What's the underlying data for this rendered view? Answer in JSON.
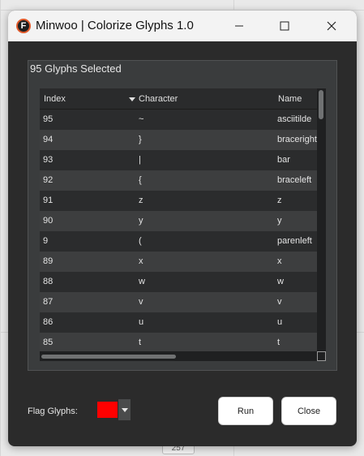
{
  "window": {
    "title": "Minwoo | Colorize Glyphs 1.0",
    "app_icon_letter": "F"
  },
  "panel": {
    "title": "95 Glyphs Selected"
  },
  "table": {
    "columns": [
      "Index",
      "Character",
      "Name"
    ],
    "sort_column": "Character",
    "rows": [
      {
        "index": "95",
        "character": "~",
        "name": "asciitilde"
      },
      {
        "index": "94",
        "character": "}",
        "name": "braceright"
      },
      {
        "index": "93",
        "character": "|",
        "name": "bar"
      },
      {
        "index": "92",
        "character": "{",
        "name": "braceleft"
      },
      {
        "index": "91",
        "character": "z",
        "name": "z"
      },
      {
        "index": "90",
        "character": "y",
        "name": "y"
      },
      {
        "index": "9",
        "character": "(",
        "name": "parenleft"
      },
      {
        "index": "89",
        "character": "x",
        "name": "x"
      },
      {
        "index": "88",
        "character": "w",
        "name": "w"
      },
      {
        "index": "87",
        "character": "v",
        "name": "v"
      },
      {
        "index": "86",
        "character": "u",
        "name": "u"
      },
      {
        "index": "85",
        "character": "t",
        "name": "t"
      }
    ]
  },
  "footer": {
    "flag_label": "Flag Glyphs:",
    "flag_color": "#ff0000",
    "run_label": "Run",
    "close_label": "Close"
  },
  "background": {
    "badge_text": "257"
  }
}
